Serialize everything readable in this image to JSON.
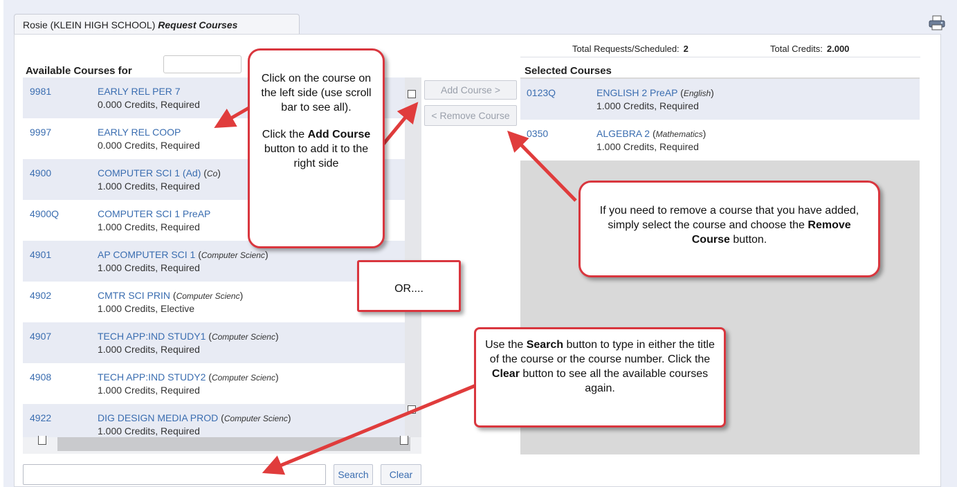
{
  "tab": {
    "student": "Rosie (KLEIN HIGH SCHOOL)",
    "page": "Request Courses"
  },
  "totals": {
    "requests_label": "Total Requests/Scheduled:",
    "requests_value": "2",
    "credits_label": "Total Credits:",
    "credits_value": "2.000"
  },
  "available_heading": "Available Courses for",
  "selected_heading": "Selected Courses",
  "available_courses": [
    {
      "num": "9981",
      "title": "EARLY REL PER 7",
      "dept": "",
      "sub": "0.000 Credits,  Required"
    },
    {
      "num": "9997",
      "title": "EARLY REL COOP",
      "dept": "",
      "sub": "0.000 Credits,  Required"
    },
    {
      "num": "4900",
      "title": "COMPUTER SCI 1 (Ad)",
      "dept": "Co",
      "sub": "1.000 Credits,  Required"
    },
    {
      "num": "4900Q",
      "title": "COMPUTER SCI 1 PreAP",
      "dept": "",
      "sub": "1.000 Credits,  Required"
    },
    {
      "num": "4901",
      "title": "AP COMPUTER SCI 1",
      "dept": "Computer Scienc",
      "sub": "1.000 Credits,  Required"
    },
    {
      "num": "4902",
      "title": "CMTR SCI PRIN",
      "dept": "Computer Scienc",
      "sub": "1.000 Credits,  Elective"
    },
    {
      "num": "4907",
      "title": "TECH APP:IND STUDY1",
      "dept": "Computer Scienc",
      "sub": "1.000 Credits,  Required"
    },
    {
      "num": "4908",
      "title": "TECH APP:IND STUDY2",
      "dept": "Computer Scienc",
      "sub": "1.000 Credits,  Required"
    },
    {
      "num": "4922",
      "title": "DIG DESIGN MEDIA PROD",
      "dept": "Computer Scienc",
      "sub": "1.000 Credits,  Required"
    }
  ],
  "selected_courses": [
    {
      "num": "0123Q",
      "title": "ENGLISH 2 PreAP",
      "dept": "English",
      "sub": "1.000 Credits,  Required"
    },
    {
      "num": "0350",
      "title": "ALGEBRA 2",
      "dept": "Mathematics",
      "sub": "1.000 Credits,  Required"
    }
  ],
  "buttons": {
    "add": "Add Course >",
    "remove": "< Remove Course",
    "search": "Search",
    "clear": "Clear"
  },
  "search": {
    "value": "",
    "placeholder": ""
  },
  "callouts": {
    "add_pre": "Click on the course on the left side (use scroll bar to see all).",
    "add_mid1": "Click the ",
    "add_bold": "Add Course",
    "add_post": " button to add it to the right side",
    "remove_pre": "If you need to remove a course that you have added, simply select the course and choose the ",
    "remove_bold": "Remove Course",
    "remove_post": " button.",
    "or": "OR....",
    "search_pre": "Use the ",
    "search_bold1": "Search",
    "search_mid": " button to type in either the title of the course or the course number.  Click the ",
    "search_bold2": "Clear",
    "search_post": " button to see all the available courses again."
  },
  "colors": {
    "link": "#3a6db0",
    "callout_border": "#d9363e",
    "arrow": "#e03c3c",
    "row_alt": "#e8ebf4"
  },
  "icons": {
    "print": "printer-icon"
  }
}
